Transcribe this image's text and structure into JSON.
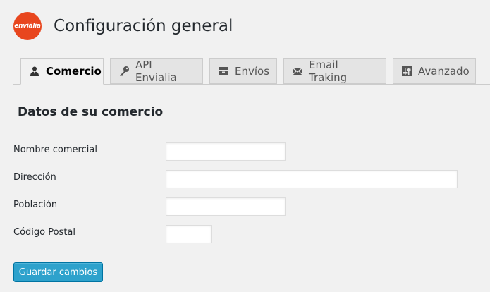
{
  "header": {
    "logo_text": "enviália",
    "title": "Configuración general"
  },
  "tabs": [
    {
      "label": "Comercio",
      "icon": "user-icon",
      "active": true
    },
    {
      "label": "API Envialia",
      "icon": "key-icon",
      "active": false
    },
    {
      "label": "Envíos",
      "icon": "archive-box-icon",
      "active": false
    },
    {
      "label": "Email Traking",
      "icon": "envelope-icon",
      "active": false
    },
    {
      "label": "Avanzado",
      "icon": "sliders-icon",
      "active": false
    }
  ],
  "section": {
    "title": "Datos de su comercio"
  },
  "form": {
    "fields": [
      {
        "label": "Nombre comercial",
        "value": ""
      },
      {
        "label": "Dirección",
        "value": ""
      },
      {
        "label": "Población",
        "value": ""
      },
      {
        "label": "Código Postal",
        "value": ""
      }
    ]
  },
  "actions": {
    "save_label": "Guardar cambios"
  },
  "colors": {
    "background": "#f1f1f1",
    "logo": "#e8461e",
    "button": "#2ea2cc"
  }
}
